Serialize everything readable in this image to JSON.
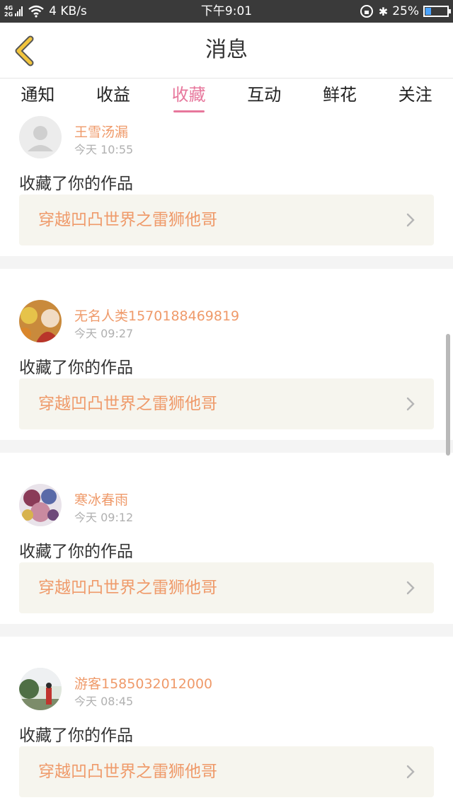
{
  "status_bar": {
    "network": [
      "4G",
      "2G"
    ],
    "speed": "4 KB/s",
    "time": "下午9:01",
    "battery": "25%"
  },
  "header": {
    "title": "消息"
  },
  "tabs": [
    {
      "label": "通知",
      "active": false
    },
    {
      "label": "收益",
      "active": false
    },
    {
      "label": "收藏",
      "active": true
    },
    {
      "label": "互动",
      "active": false
    },
    {
      "label": "鲜花",
      "active": false
    },
    {
      "label": "关注",
      "active": false
    }
  ],
  "messages": [
    {
      "user": "王雪汤漏",
      "time": "今天 10:55",
      "action": "收藏了你的作品",
      "work": "穿越凹凸世界之雷狮他哥"
    },
    {
      "user": "无名人类1570188469819",
      "time": "今天 09:27",
      "action": "收藏了你的作品",
      "work": "穿越凹凸世界之雷狮他哥"
    },
    {
      "user": "寒冰春雨",
      "time": "今天 09:12",
      "action": "收藏了你的作品",
      "work": "穿越凹凸世界之雷狮他哥"
    },
    {
      "user": "游客1585032012000",
      "time": "今天 08:45",
      "action": "收藏了你的作品",
      "work": "穿越凹凸世界之雷狮他哥"
    }
  ],
  "colors": {
    "accent": "#e7779c",
    "username": "#ef9a6a",
    "back_icon": "#f2c53d"
  }
}
